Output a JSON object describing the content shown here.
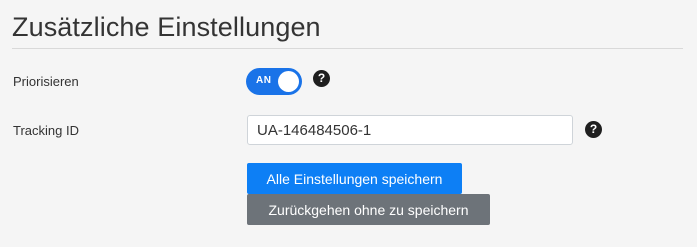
{
  "page": {
    "title": "Zusätzliche Einstellungen"
  },
  "settings": {
    "prioritize": {
      "label": "Priorisieren",
      "toggle_text": "AN",
      "enabled": true,
      "help_icon": "question-circle-icon"
    },
    "tracking": {
      "label": "Tracking ID",
      "value": "UA-146484506-1",
      "help_icon": "question-circle-icon"
    }
  },
  "actions": {
    "save_label": "Alle Einstellungen speichern",
    "back_label": "Zurückgehen ohne zu speichern"
  },
  "colors": {
    "toggle_on": "#1a73e8",
    "primary_button": "#0d7ff5",
    "secondary_button": "#6d7379",
    "background": "#f5f5f5"
  }
}
